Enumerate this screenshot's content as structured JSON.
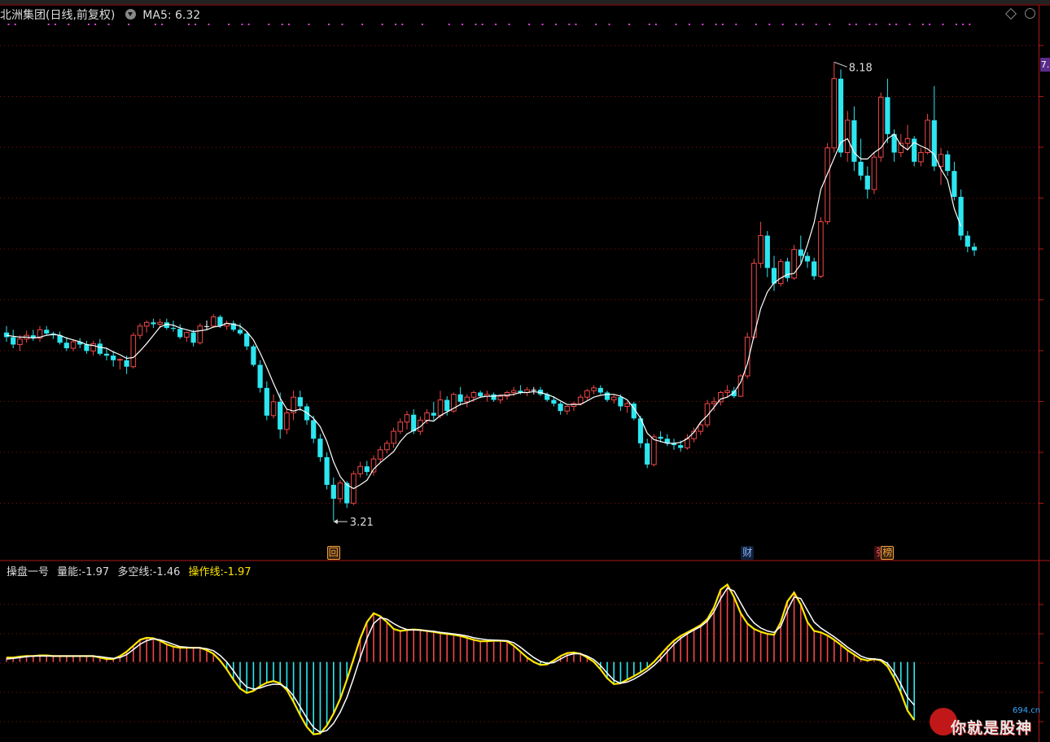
{
  "header": {
    "title": "北洲集团(日线,前复权)",
    "ma_label": "MA5:",
    "ma_value": "6.32"
  },
  "right_axis": {
    "badge": "7."
  },
  "annotations": {
    "high_label": "8.18",
    "low_label": "3.21"
  },
  "event_tags": [
    {
      "text": "回",
      "style": "orange"
    },
    {
      "text": "财",
      "style": "blue"
    },
    {
      "text": "张",
      "style": "red"
    },
    {
      "text": "榜",
      "style": "orange"
    }
  ],
  "indicator": {
    "name": "操盘一号",
    "items": [
      {
        "label": "量能:",
        "value": "-1.97"
      },
      {
        "label": "多空线:",
        "value": "-1.46"
      },
      {
        "label": "操作线:",
        "value": "-1.97"
      }
    ]
  },
  "watermark": {
    "site": "694.cn",
    "text": "你就是股神"
  },
  "colors": {
    "up": "#f04848",
    "down": "#2ce6f0",
    "doji": "#ffffff",
    "ma": "#ffffff",
    "purple": "#e040e0",
    "yellow": "#ffe600",
    "grid": "#8a1010"
  },
  "chart_data": [
    {
      "type": "candlestick",
      "title": "北洲集团(日线,前复权)",
      "series_ma": {
        "name": "MA5",
        "last": 6.32
      },
      "ylim": [
        3.0,
        8.5
      ],
      "annotated_high": 8.18,
      "annotated_low": 3.21,
      "ohlc": [
        [
          5.25,
          5.32,
          5.15,
          5.2
        ],
        [
          5.2,
          5.28,
          5.08,
          5.12
        ],
        [
          5.12,
          5.22,
          5.05,
          5.18
        ],
        [
          5.18,
          5.27,
          5.14,
          5.22
        ],
        [
          5.22,
          5.28,
          5.16,
          5.19
        ],
        [
          5.19,
          5.32,
          5.15,
          5.28
        ],
        [
          5.28,
          5.32,
          5.22,
          5.24
        ],
        [
          5.24,
          5.26,
          5.18,
          5.22
        ],
        [
          5.22,
          5.26,
          5.12,
          5.14
        ],
        [
          5.14,
          5.2,
          5.05,
          5.08
        ],
        [
          5.08,
          5.18,
          5.05,
          5.15
        ],
        [
          5.15,
          5.19,
          5.08,
          5.12
        ],
        [
          5.12,
          5.16,
          5.02,
          5.05
        ],
        [
          5.05,
          5.16,
          5.0,
          5.13
        ],
        [
          5.13,
          5.18,
          5.0,
          5.02
        ],
        [
          5.02,
          5.08,
          4.95,
          5.0
        ],
        [
          5.0,
          5.05,
          4.88,
          4.95
        ],
        [
          4.95,
          4.97,
          4.85,
          4.96
        ],
        [
          4.95,
          5.0,
          4.8,
          4.88
        ],
        [
          4.88,
          5.25,
          4.86,
          5.22
        ],
        [
          5.22,
          5.35,
          5.18,
          5.32
        ],
        [
          5.32,
          5.38,
          5.25,
          5.36
        ],
        [
          5.36,
          5.4,
          5.3,
          5.34
        ],
        [
          5.34,
          5.4,
          5.3,
          5.36
        ],
        [
          5.36,
          5.4,
          5.28,
          5.3
        ],
        [
          5.3,
          5.38,
          5.26,
          5.29
        ],
        [
          5.29,
          5.34,
          5.18,
          5.2
        ],
        [
          5.2,
          5.26,
          5.15,
          5.25
        ],
        [
          5.25,
          5.28,
          5.1,
          5.14
        ],
        [
          5.14,
          5.35,
          5.12,
          5.32
        ],
        [
          5.32,
          5.38,
          5.28,
          5.32
        ],
        [
          5.32,
          5.45,
          5.3,
          5.42
        ],
        [
          5.42,
          5.44,
          5.3,
          5.32
        ],
        [
          5.32,
          5.38,
          5.28,
          5.35
        ],
        [
          5.35,
          5.38,
          5.26,
          5.28
        ],
        [
          5.28,
          5.35,
          5.22,
          5.24
        ],
        [
          5.24,
          5.26,
          5.06,
          5.1
        ],
        [
          5.1,
          5.12,
          4.88,
          4.9
        ],
        [
          4.9,
          4.95,
          4.6,
          4.65
        ],
        [
          4.65,
          4.72,
          4.3,
          4.35
        ],
        [
          4.35,
          4.58,
          4.32,
          4.5
        ],
        [
          4.5,
          4.6,
          4.1,
          4.2
        ],
        [
          4.2,
          4.42,
          4.15,
          4.38
        ],
        [
          4.38,
          4.62,
          4.3,
          4.55
        ],
        [
          4.55,
          4.62,
          4.4,
          4.45
        ],
        [
          4.45,
          4.48,
          4.25,
          4.3
        ],
        [
          4.3,
          4.35,
          4.05,
          4.1
        ],
        [
          4.1,
          4.15,
          3.85,
          3.9
        ],
        [
          3.9,
          3.95,
          3.55,
          3.6
        ],
        [
          3.6,
          3.68,
          3.21,
          3.45
        ],
        [
          3.45,
          3.65,
          3.4,
          3.62
        ],
        [
          3.62,
          3.64,
          3.35,
          3.4
        ],
        [
          3.4,
          3.75,
          3.38,
          3.72
        ],
        [
          3.72,
          3.85,
          3.68,
          3.8
        ],
        [
          3.8,
          3.86,
          3.7,
          3.74
        ],
        [
          3.74,
          3.92,
          3.7,
          3.88
        ],
        [
          3.88,
          4.02,
          3.84,
          3.98
        ],
        [
          3.98,
          4.08,
          3.94,
          4.05
        ],
        [
          4.05,
          4.22,
          4.0,
          4.18
        ],
        [
          4.18,
          4.32,
          4.15,
          4.28
        ],
        [
          4.28,
          4.4,
          4.2,
          4.36
        ],
        [
          4.36,
          4.42,
          4.15,
          4.18
        ],
        [
          4.18,
          4.34,
          4.14,
          4.3
        ],
        [
          4.3,
          4.42,
          4.26,
          4.38
        ],
        [
          4.38,
          4.5,
          4.3,
          4.35
        ],
        [
          4.35,
          4.62,
          4.32,
          4.52
        ],
        [
          4.52,
          4.56,
          4.35,
          4.4
        ],
        [
          4.4,
          4.6,
          4.38,
          4.58
        ],
        [
          4.58,
          4.66,
          4.46,
          4.5
        ],
        [
          4.5,
          4.58,
          4.44,
          4.55
        ],
        [
          4.55,
          4.62,
          4.5,
          4.6
        ],
        [
          4.6,
          4.62,
          4.54,
          4.56
        ],
        [
          4.56,
          4.62,
          4.5,
          4.58
        ],
        [
          4.58,
          4.6,
          4.5,
          4.52
        ],
        [
          4.52,
          4.58,
          4.48,
          4.56
        ],
        [
          4.56,
          4.62,
          4.52,
          4.6
        ],
        [
          4.6,
          4.66,
          4.56,
          4.62
        ],
        [
          4.62,
          4.68,
          4.58,
          4.6
        ],
        [
          4.6,
          4.66,
          4.56,
          4.63
        ],
        [
          4.63,
          4.66,
          4.58,
          4.63
        ],
        [
          4.63,
          4.66,
          4.56,
          4.58
        ],
        [
          4.58,
          4.6,
          4.5,
          4.52
        ],
        [
          4.52,
          4.56,
          4.45,
          4.48
        ],
        [
          4.48,
          4.5,
          4.36,
          4.4
        ],
        [
          4.4,
          4.46,
          4.36,
          4.45
        ],
        [
          4.45,
          4.5,
          4.4,
          4.48
        ],
        [
          4.48,
          4.58,
          4.46,
          4.55
        ],
        [
          4.55,
          4.64,
          4.52,
          4.62
        ],
        [
          4.62,
          4.68,
          4.58,
          4.65
        ],
        [
          4.65,
          4.68,
          4.58,
          4.6
        ],
        [
          4.6,
          4.62,
          4.5,
          4.52
        ],
        [
          4.52,
          4.58,
          4.48,
          4.55
        ],
        [
          4.55,
          4.58,
          4.4,
          4.45
        ],
        [
          4.45,
          4.5,
          4.38,
          4.48
        ],
        [
          4.48,
          4.5,
          4.3,
          4.32
        ],
        [
          4.32,
          4.35,
          4.0,
          4.05
        ],
        [
          4.05,
          4.1,
          3.78,
          3.82
        ],
        [
          3.82,
          4.15,
          3.8,
          4.12
        ],
        [
          4.12,
          4.18,
          4.06,
          4.1
        ],
        [
          4.1,
          4.15,
          4.02,
          4.05
        ],
        [
          4.05,
          4.1,
          3.98,
          4.03
        ],
        [
          4.03,
          4.08,
          3.96,
          4.0
        ],
        [
          4.0,
          4.15,
          3.98,
          4.1
        ],
        [
          4.1,
          4.22,
          4.06,
          4.18
        ],
        [
          4.18,
          4.28,
          4.14,
          4.25
        ],
        [
          4.25,
          4.52,
          4.22,
          4.48
        ],
        [
          4.48,
          4.55,
          4.4,
          4.5
        ],
        [
          4.5,
          4.62,
          4.46,
          4.6
        ],
        [
          4.6,
          4.68,
          4.55,
          4.62
        ],
        [
          4.62,
          4.66,
          4.54,
          4.56
        ],
        [
          4.56,
          4.8,
          4.55,
          4.78
        ],
        [
          4.78,
          5.25,
          4.75,
          5.2
        ],
        [
          5.2,
          6.05,
          5.18,
          6.0
        ],
        [
          6.0,
          6.45,
          5.95,
          6.3
        ],
        [
          6.3,
          6.35,
          5.85,
          5.95
        ],
        [
          5.95,
          6.08,
          5.7,
          5.78
        ],
        [
          5.78,
          6.05,
          5.75,
          6.02
        ],
        [
          6.02,
          6.06,
          5.8,
          5.84
        ],
        [
          5.84,
          6.2,
          5.82,
          6.15
        ],
        [
          6.15,
          6.3,
          6.0,
          6.08
        ],
        [
          6.08,
          6.12,
          5.95,
          6.02
        ],
        [
          6.02,
          6.06,
          5.82,
          5.86
        ],
        [
          5.86,
          6.5,
          5.84,
          6.45
        ],
        [
          6.45,
          7.3,
          6.42,
          7.25
        ],
        [
          7.25,
          8.18,
          7.2,
          8.0
        ],
        [
          8.0,
          8.1,
          7.15,
          7.2
        ],
        [
          7.2,
          7.65,
          7.1,
          7.55
        ],
        [
          7.55,
          7.7,
          7.0,
          7.1
        ],
        [
          7.1,
          7.35,
          6.9,
          6.95
        ],
        [
          6.95,
          7.05,
          6.7,
          6.8
        ],
        [
          6.8,
          7.2,
          6.75,
          7.15
        ],
        [
          7.15,
          7.85,
          7.1,
          7.8
        ],
        [
          7.8,
          8.0,
          7.3,
          7.4
        ],
        [
          7.4,
          7.45,
          7.1,
          7.2
        ],
        [
          7.2,
          7.4,
          7.15,
          7.3
        ],
        [
          7.3,
          7.5,
          7.22,
          7.35
        ],
        [
          7.35,
          7.38,
          7.05,
          7.1
        ],
        [
          7.1,
          7.25,
          7.05,
          7.2
        ],
        [
          7.2,
          7.62,
          7.18,
          7.55
        ],
        [
          7.55,
          7.92,
          7.0,
          7.05
        ],
        [
          7.05,
          7.25,
          6.85,
          7.18
        ],
        [
          7.18,
          7.22,
          6.95,
          7.0
        ],
        [
          7.0,
          7.1,
          6.68,
          6.72
        ],
        [
          6.72,
          6.8,
          6.25,
          6.3
        ],
        [
          6.3,
          6.35,
          6.12,
          6.18
        ],
        [
          6.18,
          6.22,
          6.08,
          6.14
        ]
      ],
      "ma5": [
        5.22,
        5.21,
        5.2,
        5.2,
        5.19,
        5.2,
        5.22,
        5.23,
        5.22,
        5.19,
        5.17,
        5.15,
        5.12,
        5.11,
        5.09,
        5.08,
        5.04,
        5.01,
        4.97,
        4.98,
        5.05,
        5.13,
        5.22,
        5.31,
        5.34,
        5.33,
        5.3,
        5.28,
        5.26,
        5.27,
        5.28,
        5.31,
        5.32,
        5.35,
        5.34,
        5.32,
        5.26,
        5.17,
        5.03,
        4.87,
        4.7,
        4.54,
        4.42,
        4.4,
        4.42,
        4.38,
        4.32,
        4.23,
        4.07,
        3.85,
        3.69,
        3.6,
        3.56,
        3.6,
        3.65,
        3.77,
        3.84,
        3.9,
        3.96,
        4.07,
        4.15,
        4.19,
        4.23,
        4.3,
        4.29,
        4.35,
        4.39,
        4.43,
        4.47,
        4.49,
        4.52,
        4.55,
        4.56,
        4.56,
        4.57,
        4.57,
        4.58,
        4.6,
        4.6,
        4.61,
        4.6,
        4.58,
        4.55,
        4.51,
        4.47,
        4.47,
        4.47,
        4.51,
        4.55,
        4.57,
        4.58,
        4.58,
        4.56,
        4.52,
        4.43,
        4.32,
        4.16,
        4.09,
        4.07,
        4.05,
        4.05,
        4.06,
        4.1,
        4.17,
        4.28,
        4.35,
        4.44,
        4.53,
        4.55,
        4.6,
        4.71,
        4.91,
        5.22,
        5.51,
        5.69,
        5.79,
        5.84,
        5.88,
        5.89,
        5.99,
        6.2,
        6.44,
        6.8,
        6.97,
        7.14,
        7.31,
        7.35,
        7.2,
        7.13,
        7.13,
        7.2,
        7.25,
        7.35,
        7.4,
        7.28,
        7.23,
        7.31,
        7.27,
        7.24,
        7.18,
        7.02,
        6.9,
        6.59,
        6.4
      ],
      "event_markers": [
        {
          "index": 49,
          "text": "回"
        },
        {
          "index": 111,
          "text": "财"
        },
        {
          "index": 131,
          "text": "张"
        },
        {
          "index": 132,
          "text": "榜"
        }
      ]
    },
    {
      "type": "bar+line",
      "title": "操盘一号",
      "series": [
        {
          "name": "量能",
          "last": -1.97
        },
        {
          "name": "多空线",
          "last": -1.46
        },
        {
          "name": "操作线",
          "last": -1.97
        }
      ],
      "ylim": [
        -2.6,
        2.8
      ],
      "energy": [
        0.15,
        0.15,
        0.18,
        0.2,
        0.2,
        0.22,
        0.22,
        0.2,
        0.2,
        0.2,
        0.2,
        0.2,
        0.2,
        0.2,
        0.15,
        0.1,
        0.1,
        0.2,
        0.35,
        0.55,
        0.75,
        0.82,
        0.8,
        0.72,
        0.6,
        0.52,
        0.48,
        0.48,
        0.48,
        0.48,
        0.4,
        0.28,
        0.05,
        -0.25,
        -0.6,
        -0.9,
        -1.05,
        -0.98,
        -0.82,
        -0.7,
        -0.65,
        -0.72,
        -0.95,
        -1.35,
        -1.8,
        -2.2,
        -2.45,
        -2.42,
        -2.15,
        -1.75,
        -1.25,
        -0.6,
        0.1,
        0.8,
        1.35,
        1.65,
        1.55,
        1.35,
        1.12,
        1.05,
        1.08,
        1.1,
        1.08,
        1.05,
        1.02,
        0.98,
        0.95,
        0.92,
        0.88,
        0.82,
        0.75,
        0.7,
        0.7,
        0.72,
        0.72,
        0.7,
        0.55,
        0.35,
        0.15,
        0.0,
        -0.1,
        -0.08,
        0.05,
        0.2,
        0.3,
        0.32,
        0.28,
        0.15,
        0.0,
        -0.25,
        -0.55,
        -0.75,
        -0.72,
        -0.6,
        -0.48,
        -0.35,
        -0.2,
        0.0,
        0.25,
        0.5,
        0.72,
        0.88,
        1.0,
        1.12,
        1.25,
        1.45,
        1.85,
        2.45,
        2.62,
        2.2,
        1.65,
        1.3,
        1.12,
        1.02,
        0.95,
        0.92,
        1.35,
        2.05,
        2.35,
        1.95,
        1.35,
        1.05,
        1.0,
        0.9,
        0.75,
        0.58,
        0.4,
        0.25,
        0.1,
        0.05,
        0.1,
        0.05,
        -0.15,
        -0.55,
        -1.05,
        -1.65,
        -1.97
      ],
      "long_short": [
        0.1,
        0.12,
        0.15,
        0.18,
        0.2,
        0.2,
        0.2,
        0.2,
        0.2,
        0.2,
        0.2,
        0.2,
        0.2,
        0.2,
        0.18,
        0.15,
        0.12,
        0.15,
        0.25,
        0.42,
        0.6,
        0.72,
        0.78,
        0.75,
        0.68,
        0.6,
        0.52,
        0.5,
        0.48,
        0.48,
        0.45,
        0.38,
        0.22,
        0.0,
        -0.3,
        -0.62,
        -0.85,
        -0.92,
        -0.88,
        -0.8,
        -0.75,
        -0.76,
        -0.88,
        -1.15,
        -1.52,
        -1.9,
        -2.22,
        -2.38,
        -2.32,
        -2.08,
        -1.7,
        -1.2,
        -0.55,
        0.15,
        0.8,
        1.3,
        1.5,
        1.45,
        1.3,
        1.18,
        1.1,
        1.08,
        1.08,
        1.06,
        1.04,
        1.0,
        0.98,
        0.95,
        0.92,
        0.88,
        0.82,
        0.78,
        0.75,
        0.74,
        0.73,
        0.72,
        0.65,
        0.5,
        0.32,
        0.15,
        0.02,
        -0.05,
        -0.02,
        0.1,
        0.22,
        0.28,
        0.28,
        0.2,
        0.08,
        -0.12,
        -0.38,
        -0.62,
        -0.72,
        -0.68,
        -0.58,
        -0.45,
        -0.3,
        -0.12,
        0.1,
        0.35,
        0.6,
        0.8,
        0.95,
        1.08,
        1.2,
        1.38,
        1.7,
        2.15,
        2.5,
        2.4,
        2.0,
        1.6,
        1.32,
        1.15,
        1.05,
        1.0,
        1.2,
        1.75,
        2.2,
        2.15,
        1.75,
        1.35,
        1.15,
        1.0,
        0.85,
        0.68,
        0.5,
        0.35,
        0.2,
        0.12,
        0.1,
        0.08,
        -0.05,
        -0.35,
        -0.75,
        -1.2,
        -1.46
      ]
    }
  ]
}
